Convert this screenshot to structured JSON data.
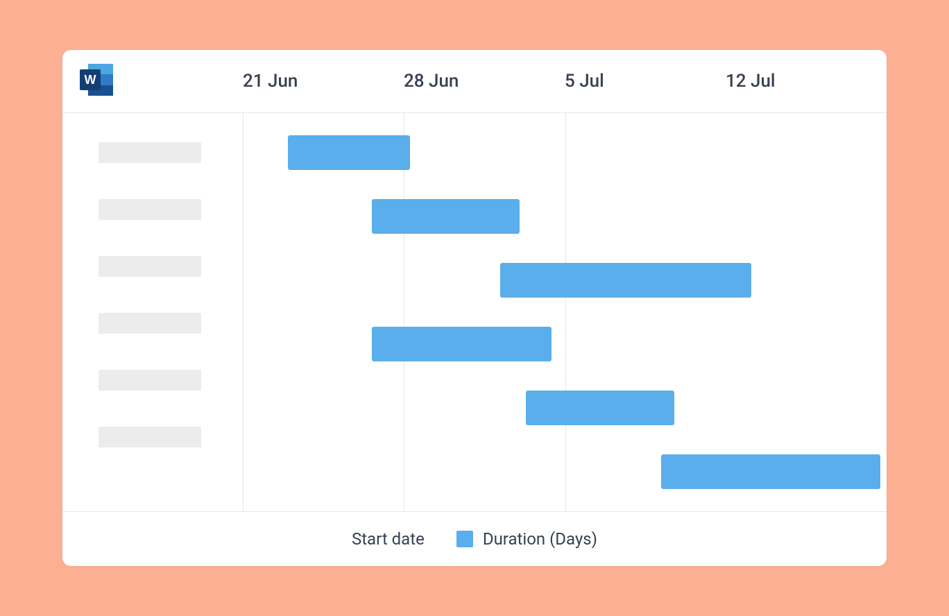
{
  "timeline": {
    "headers": [
      "21 Jun",
      "28 Jun",
      "5 Jul",
      "12 Jul"
    ]
  },
  "legend": {
    "start": "Start date",
    "duration": "Duration (Days)"
  },
  "colors": {
    "bar": "#5AAEEB",
    "bg": "#FCAF93"
  },
  "chart_data": {
    "type": "bar",
    "title": "",
    "xlabel": "",
    "ylabel": "",
    "x_axis_dates": [
      "21 Jun",
      "28 Jun",
      "5 Jul",
      "12 Jul"
    ],
    "series": [
      {
        "name": "Duration (Days)",
        "values": [
          {
            "task": 1,
            "start": "22 Jun",
            "duration_days": 5,
            "start_pct": 7,
            "width_pct": 19
          },
          {
            "task": 2,
            "start": "26 Jun",
            "duration_days": 6,
            "start_pct": 20,
            "width_pct": 23
          },
          {
            "task": 3,
            "start": "1 Jul",
            "duration_days": 10,
            "start_pct": 40,
            "width_pct": 39
          },
          {
            "task": 4,
            "start": "26 Jun",
            "duration_days": 7,
            "start_pct": 20,
            "width_pct": 28
          },
          {
            "task": 5,
            "start": "3 Jul",
            "duration_days": 6,
            "start_pct": 44,
            "width_pct": 23
          },
          {
            "task": 6,
            "start": "9 Jul",
            "duration_days": 9,
            "start_pct": 65,
            "width_pct": 34
          }
        ]
      }
    ],
    "legend": [
      "Start date",
      "Duration (Days)"
    ]
  }
}
